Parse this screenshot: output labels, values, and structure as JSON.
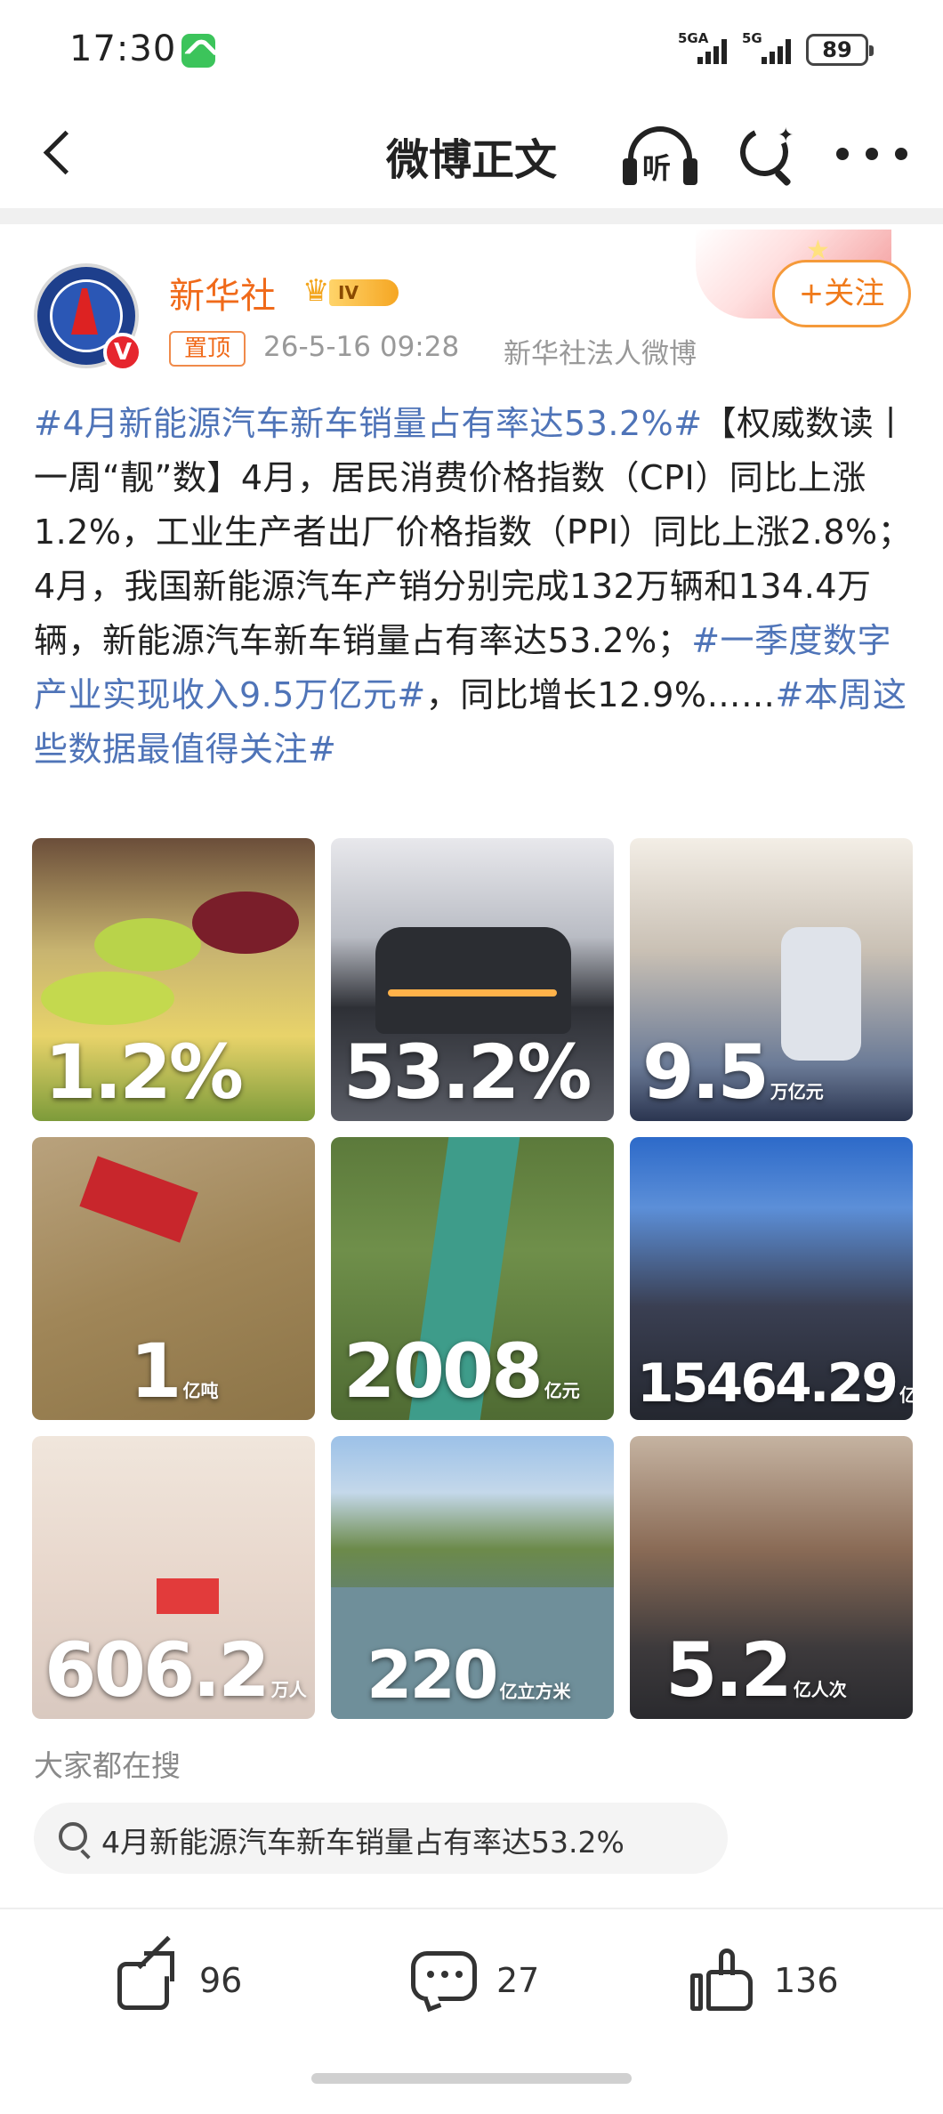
{
  "status_bar": {
    "time": "17:30",
    "signal_1": "5GA",
    "signal_2": "5G",
    "battery": "89",
    "app_icon": "phone-icon"
  },
  "nav": {
    "title": "微博正文",
    "listen_label": "听",
    "icons": [
      "back-icon",
      "listen-icon",
      "search-icon",
      "more-icon"
    ]
  },
  "post": {
    "author": "新华社",
    "level": "IV",
    "follow_label": "+关注",
    "pinned_label": "置顶",
    "time": "26-5-16 09:28",
    "source": "新华社法人微博",
    "body": {
      "topic1": "#4月新能源汽车新车销量占有率达53.2%#",
      "text1": "【权威数读丨一周“靓”数】4月，居民消费价格指数（CPI）同比上涨1.2%，工业生产者出厂价格指数（PPI）同比上涨2.8%；4月，我国新能源汽车产销分别完成132万辆和134.4万辆，新能源汽车新车销量占有率达53.2%；",
      "topic2": "#一季度数字产业实现收入9.5万亿元#",
      "text2": "，同比增长12.9%……",
      "topic3": "#本周这些数据最值得关注#"
    }
  },
  "images": [
    {
      "value": "1.2%",
      "unit": ""
    },
    {
      "value": "53.2%",
      "unit": ""
    },
    {
      "value": "9.5",
      "unit": "万亿元"
    },
    {
      "value": "1",
      "unit": "亿吨"
    },
    {
      "value": "2008",
      "unit": "亿元"
    },
    {
      "value": "15464.29",
      "unit": "亿元"
    },
    {
      "value": "606.2",
      "unit": "万人"
    },
    {
      "value": "220",
      "unit": "亿立方米"
    },
    {
      "value": "5.2",
      "unit": "亿人次"
    }
  ],
  "search": {
    "section_label": "大家都在搜",
    "query": "4月新能源汽车新车销量占有率达53.2%"
  },
  "actions": {
    "share_count": "96",
    "comment_count": "27",
    "like_count": "136"
  },
  "colors": {
    "topic": "#4f74b8",
    "author": "#f06a1a",
    "follow": "#f07a1a"
  }
}
